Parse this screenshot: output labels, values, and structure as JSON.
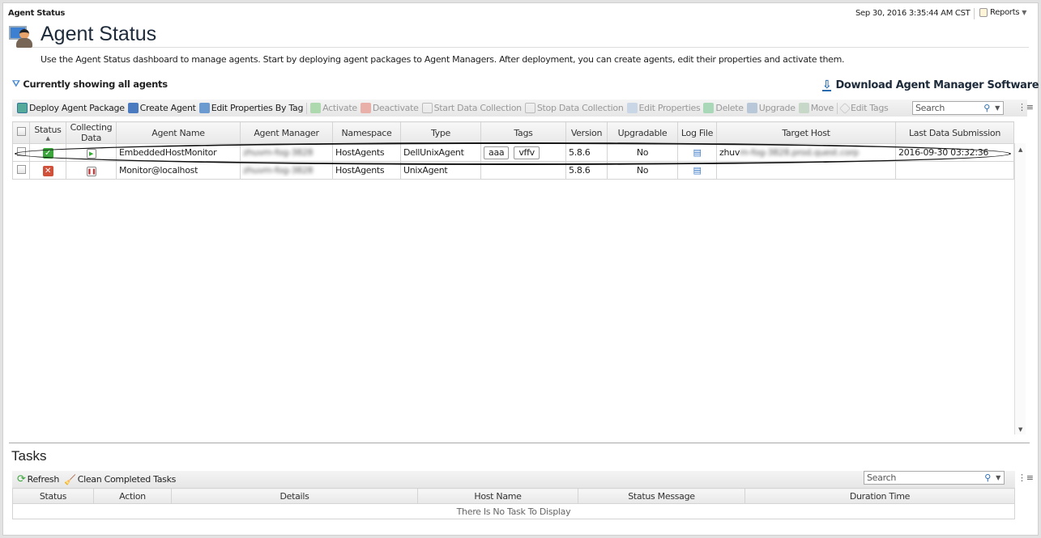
{
  "header": {
    "breadcrumb": "Agent Status",
    "datetime": "Sep 30, 2016 3:35:44 AM CST",
    "reports_label": "Reports"
  },
  "page": {
    "title": "Agent Status",
    "description": "Use the Agent Status dashboard to manage agents. Start by deploying agent packages to Agent Managers. After deployment, you can create agents, edit their properties and activate them.",
    "filter_status": "Currently showing all agents",
    "download_label": "Download Agent Manager Software"
  },
  "toolbar": {
    "deploy": "Deploy Agent Package",
    "create": "Create Agent",
    "edit_by_tag": "Edit Properties By Tag",
    "activate": "Activate",
    "deactivate": "Deactivate",
    "start": "Start Data Collection",
    "stop": "Stop Data Collection",
    "edit_props": "Edit Properties",
    "delete": "Delete",
    "upgrade": "Upgrade",
    "move": "Move",
    "edit_tags": "Edit Tags",
    "search_placeholder": "Search"
  },
  "agents": {
    "columns": [
      "Status",
      "Collecting Data",
      "Agent Name",
      "Agent Manager",
      "Namespace",
      "Type",
      "Tags",
      "Version",
      "Upgradable",
      "Log File",
      "Target Host",
      "Last Data Submission"
    ],
    "collecting_line1": "Collecting",
    "collecting_line2": "Data",
    "rows": [
      {
        "status": "active",
        "collecting": "running",
        "name": "EmbeddedHostMonitor",
        "manager": "zhuvm-fog-3828",
        "namespace": "HostAgents",
        "type": "DellUnixAgent",
        "tags": [
          "aaa",
          "vffv"
        ],
        "version": "5.8.6",
        "upgradable": "No",
        "target_host_prefix": "zhuv",
        "target_host_rest": "m-fog-3828.prod.quest.corp",
        "last_submission": "2016-09-30 03:32:36"
      },
      {
        "status": "inactive",
        "collecting": "paused",
        "name": "Monitor@localhost",
        "manager": "zhuvm-fog-3828",
        "namespace": "HostAgents",
        "type": "UnixAgent",
        "tags": [],
        "version": "5.8.6",
        "upgradable": "No",
        "target_host_prefix": "",
        "target_host_rest": "",
        "last_submission": ""
      }
    ]
  },
  "tasks": {
    "title": "Tasks",
    "refresh": "Refresh",
    "clean": "Clean Completed Tasks",
    "search_placeholder": "Search",
    "columns": [
      "Status",
      "Action",
      "Details",
      "Host Name",
      "Status Message",
      "Duration Time"
    ],
    "empty": "There Is No Task To Display"
  },
  "colors": {
    "active": "#3aa53a",
    "inactive": "#d0503a",
    "accent": "#2a6bb0"
  }
}
